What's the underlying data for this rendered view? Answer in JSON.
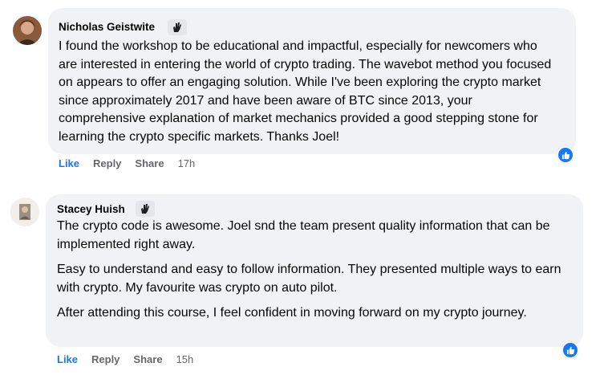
{
  "comments": [
    {
      "author": "Nicholas Geistwite",
      "paragraphs": [
        "I found the workshop to be educational and impactful, especially for newcomers who are interested in entering the world of crypto trading. The wavebot method you focused on appears to offer an engaging solution. While I've been exploring the crypto market since approximately 2017 and have been aware of BTC since 2013, your comprehensive explanation of market mechanics provided a good stepping stone for learning the crypto specific markets. Thanks Joel!"
      ],
      "actions": {
        "like": "Like",
        "reply": "Reply",
        "share": "Share",
        "time": "17h"
      },
      "reaction_icon": "like-thumb-icon",
      "badge_icon": "hand-icon"
    },
    {
      "author": "Stacey Huish",
      "paragraphs": [
        "The crypto code is awesome. Joel snd the team present quality information that can be implemented right away.",
        "Easy to understand and easy to follow information. They presented multiple ways to earn with crypto. My favourite was crypto on auto pilot.",
        "After attending this course, I feel confident in moving forward on my crypto journey."
      ],
      "actions": {
        "like": "Like",
        "reply": "Reply",
        "share": "Share",
        "time": "15h"
      },
      "reaction_icon": "like-thumb-icon",
      "badge_icon": "hand-icon"
    }
  ],
  "colors": {
    "bubble": "#f0f2f5",
    "like": "#1877f2",
    "meta": "#65676b"
  }
}
